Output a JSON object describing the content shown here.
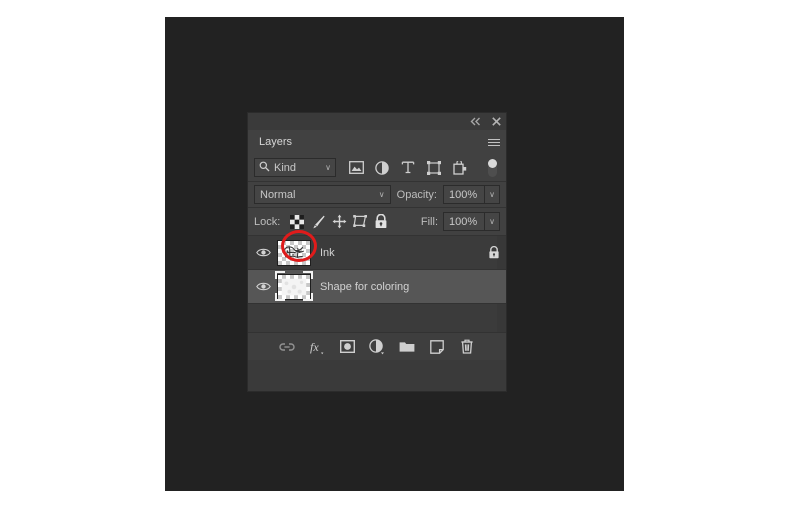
{
  "app": {
    "panel_title": "Layers"
  },
  "titlebar": {
    "collapse_icon": "double-chevron-left-icon",
    "close_icon": "close-icon"
  },
  "tabs": [
    {
      "label": "Layers",
      "active": true
    }
  ],
  "panel_menu": {
    "icon": "hamburger-menu-icon"
  },
  "filter": {
    "kind_label": "Kind",
    "search_icon": "search-icon",
    "chevron": "∨",
    "icons": [
      {
        "name": "filter-pixel-layers-icon"
      },
      {
        "name": "filter-adjustment-layers-icon"
      },
      {
        "name": "filter-type-layers-icon"
      },
      {
        "name": "filter-shape-layers-icon"
      },
      {
        "name": "filter-smart-object-icon"
      }
    ],
    "toggle": {
      "name": "filter-enable-toggle",
      "state": "off"
    }
  },
  "blend": {
    "mode": "Normal",
    "chevron": "∨",
    "opacity_label": "Opacity:",
    "opacity_value": "100%"
  },
  "lock": {
    "label": "Lock:",
    "buttons": [
      {
        "name": "lock-transparent-pixels-button",
        "icon": "checkerboard-icon",
        "highlighted": true
      },
      {
        "name": "lock-image-pixels-button",
        "icon": "brush-icon",
        "highlighted": false
      },
      {
        "name": "lock-position-button",
        "icon": "move-arrows-icon",
        "highlighted": false
      },
      {
        "name": "lock-artboard-nesting-button",
        "icon": "artboard-icon",
        "highlighted": false
      },
      {
        "name": "lock-all-button",
        "icon": "padlock-icon",
        "highlighted": false
      }
    ],
    "fill_label": "Fill:",
    "fill_value": "100%"
  },
  "layers": [
    {
      "name": "Ink",
      "visible": true,
      "selected": false,
      "locked": true,
      "thumbnail": "checkerboard-with-sketch-marks"
    },
    {
      "name": "Shape for coloring",
      "visible": true,
      "selected": true,
      "locked": false,
      "thumbnail": "checkerboard-with-light-shape"
    }
  ],
  "bottom_toolbar": [
    {
      "name": "link-layers-button",
      "icon": "chain-link-icon"
    },
    {
      "name": "layer-style-button",
      "icon": "fx-icon"
    },
    {
      "name": "add-layer-mask-button",
      "icon": "mask-icon"
    },
    {
      "name": "new-adjustment-layer-button",
      "icon": "half-circle-icon"
    },
    {
      "name": "new-group-button",
      "icon": "folder-icon"
    },
    {
      "name": "new-layer-button",
      "icon": "new-page-icon"
    },
    {
      "name": "delete-layer-button",
      "icon": "trash-icon"
    }
  ],
  "annotation": {
    "type": "red-ellipse-highlight",
    "target": "lock-transparent-pixels-button",
    "color": "#e01b1b"
  },
  "colors": {
    "backdrop": "#222222",
    "page": "#ffffff",
    "panel_bg": "#414141",
    "panel_dark": "#2f2f2f",
    "layer_selected": "#565656",
    "text": "#c8c8c8",
    "accent_red": "#e01b1b"
  }
}
